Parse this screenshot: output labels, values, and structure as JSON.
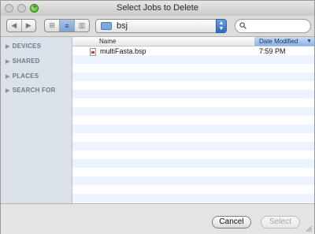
{
  "window": {
    "title": "Select Jobs to Delete"
  },
  "toolbar": {
    "location": "bsj",
    "search_placeholder": "",
    "nav": {
      "back_glyph": "◀",
      "forward_glyph": "▶"
    },
    "view_modes": [
      {
        "id": "icon",
        "glyph": "⊞",
        "selected": false
      },
      {
        "id": "list",
        "glyph": "≡",
        "selected": true
      },
      {
        "id": "column",
        "glyph": "▥",
        "selected": false
      }
    ]
  },
  "sidebar": {
    "sections": [
      {
        "label": "DEVICES"
      },
      {
        "label": "SHARED"
      },
      {
        "label": "PLACES"
      },
      {
        "label": "SEARCH FOR"
      }
    ]
  },
  "filelist": {
    "columns": {
      "name": "Name",
      "date": "Date Modified"
    },
    "sort": {
      "column": "date",
      "direction": "descending"
    },
    "files": [
      {
        "name": "multiFasta.bsp",
        "date": "7:59 PM",
        "icon": "document-icon"
      }
    ]
  },
  "buttons": {
    "cancel": "Cancel",
    "select": "Select"
  },
  "colors": {
    "selection": "#8fb4e6",
    "stripe": "#edf3fe",
    "sidebar": "#dbe1e9"
  }
}
